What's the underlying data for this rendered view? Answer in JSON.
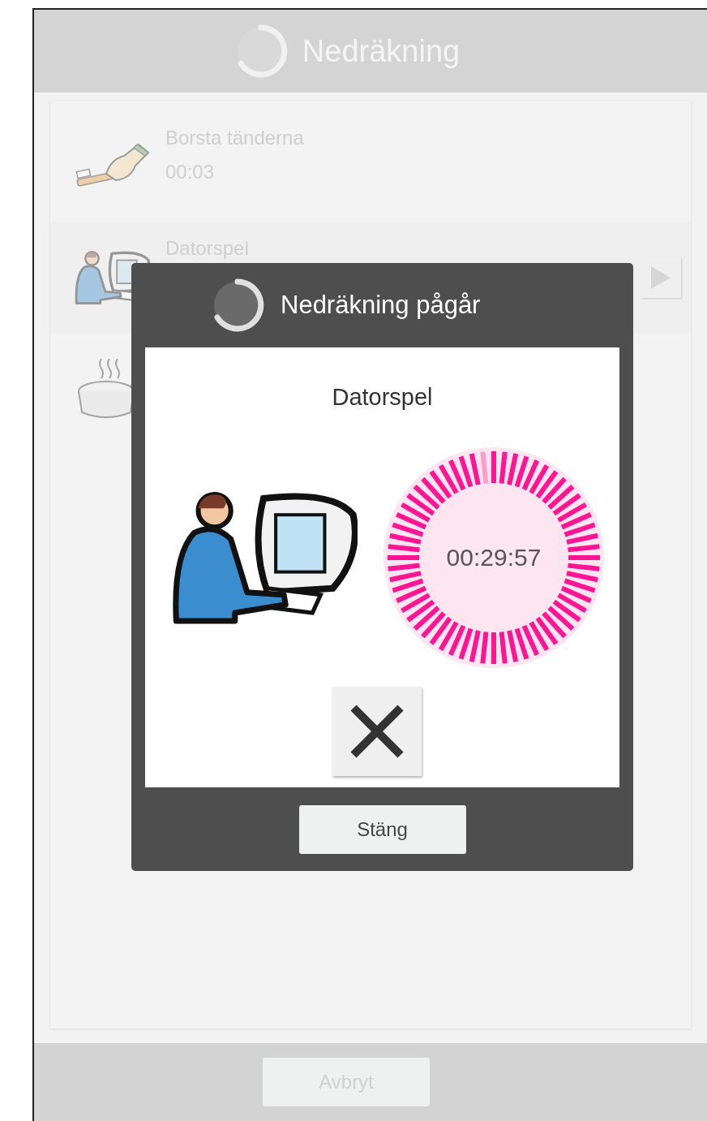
{
  "app": {
    "title": "Nedräkning"
  },
  "items": [
    {
      "kind": "toothbrush",
      "name": "Borsta tänderna",
      "time": "00:03",
      "selected": false
    },
    {
      "kind": "computer",
      "name": "Datorspel",
      "selected": true
    },
    {
      "kind": "cooking",
      "selected": false
    }
  ],
  "dialog": {
    "title": "Nedräkning pågår",
    "activity": "Datorspel",
    "timer": {
      "time": "00:29:57",
      "level": 0.983
    },
    "close_button": "Stäng"
  },
  "footer": {
    "cancel_button": "Avbryt"
  }
}
